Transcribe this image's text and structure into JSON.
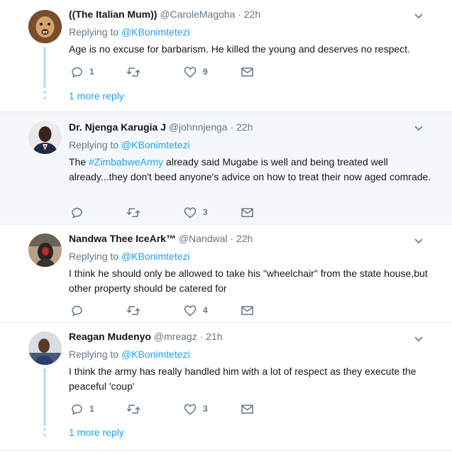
{
  "colors": {
    "link": "#1da1f2",
    "muted": "#657786",
    "text": "#14171a",
    "thread": "#c4e0f4",
    "highlight_bg": "#f5f8fa"
  },
  "icons": {
    "reply": "reply-icon",
    "retweet": "retweet-icon",
    "like": "heart-icon",
    "dm": "envelope-icon",
    "caret": "chevron-down-icon"
  },
  "tweets": [
    {
      "fullname": "((The Italian Mum))",
      "username": "@CaroleMagoha",
      "time": "22h",
      "replying_label": "Replying to",
      "replying_to": "@KBonimtetezi",
      "text": "Age is no excuse for barbarism. He killed the young and deserves no respect.",
      "replies": "1",
      "likes": "9",
      "more_replies": "1 more reply"
    },
    {
      "fullname": "Dr. Njenga Karugia J",
      "username": "@johnnjenga",
      "time": "22h",
      "replying_label": "Replying to",
      "replying_to": "@KBonimtetezi",
      "text_prefix": "The ",
      "hashtag": "#ZimbabweArmy",
      "text_suffix": " already said Mugabe is well and being treated well already...they don't beed anyone's advice on how to treat their now aged comrade.",
      "replies": "",
      "likes": "3"
    },
    {
      "fullname": "Nandwa Thee IceArk™",
      "username": "@Nandwal",
      "time": "22h",
      "replying_label": "Replying to",
      "replying_to": "@KBonimtetezi",
      "text": "I think he should only be allowed to take his \"wheelchair\" from the state house,but other property should be catered for",
      "replies": "",
      "likes": "4"
    },
    {
      "fullname": "Reagan Mudenyo",
      "username": "@mreagz",
      "time": "21h",
      "replying_label": "Replying to",
      "replying_to": "@KBonimtetezi",
      "text": "I think the army has really handled him with a lot of respect as they execute the peaceful 'coup'",
      "replies": "1",
      "likes": "3",
      "more_replies": "1 more reply"
    }
  ]
}
